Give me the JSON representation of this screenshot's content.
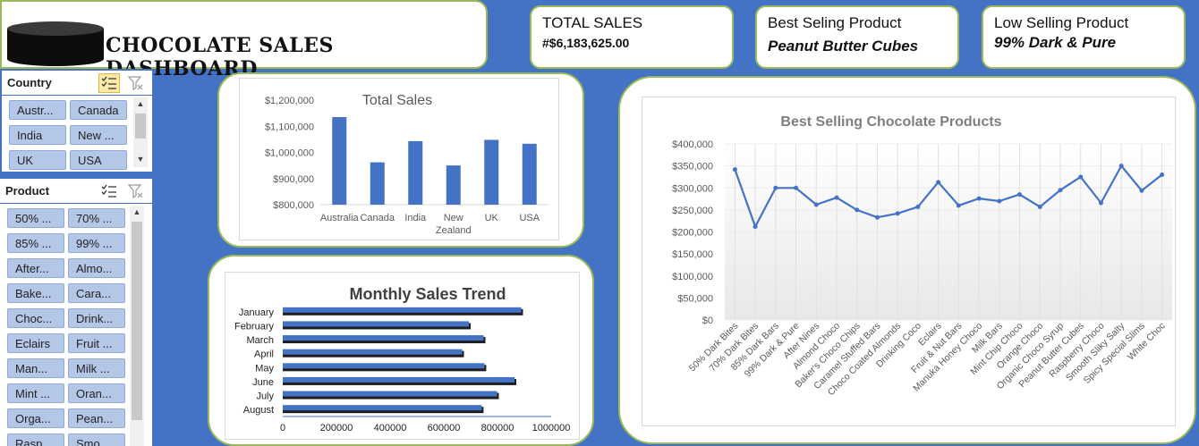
{
  "dashboard": {
    "title": "CHOCOLATE SALES DASHBOARD"
  },
  "kpis": {
    "total_sales_label": "TOTAL SALES",
    "total_sales_value": "#$6,183,625.00",
    "best_label": "Best Seling Product",
    "best_value": "Peanut Butter Cubes",
    "low_label": "Low Selling Product",
    "low_value": "99% Dark & Pure"
  },
  "country_slicer": {
    "title": "Country",
    "items": [
      "Austr...",
      "Canada",
      "India",
      "New ...",
      "UK",
      "USA"
    ]
  },
  "product_slicer": {
    "title": "Product",
    "items": [
      "50% ...",
      "70% ...",
      "85% ...",
      "99% ...",
      "After...",
      "Almo...",
      "Bake...",
      "Cara...",
      "Choc...",
      "Drink...",
      "Eclairs",
      "Fruit ...",
      "Man...",
      "Milk ...",
      "Mint ...",
      "Oran...",
      "Orga...",
      "Pean...",
      "Rasp...",
      "Smo..."
    ]
  },
  "colors": {
    "accent": "#4472c4",
    "card_border": "#9bbb59",
    "bar": "#4472c4",
    "slicer_item": "#b4c7e7"
  },
  "chart_data": [
    {
      "type": "bar",
      "title": "Total Sales",
      "categories": [
        "Australia",
        "Canada",
        "India",
        "New Zealand",
        "UK",
        "USA"
      ],
      "values": [
        1135000,
        962000,
        1043000,
        950000,
        1048000,
        1033000
      ],
      "ylim": [
        800000,
        1200000
      ],
      "yticks": [
        "$800,000",
        "$900,000",
        "$1,000,000",
        "$1,100,000",
        "$1,200,000"
      ],
      "grid": false
    },
    {
      "type": "bar",
      "orientation": "horizontal",
      "title": "Monthly Sales Trend",
      "categories": [
        "January",
        "February",
        "March",
        "April",
        "May",
        "June",
        "July",
        "August"
      ],
      "values": [
        895000,
        700000,
        755000,
        675000,
        758000,
        870000,
        805000,
        748000
      ],
      "xlim": [
        0,
        1000000
      ],
      "xticks": [
        "0",
        "200000",
        "400000",
        "600000",
        "800000",
        "1000000"
      ]
    },
    {
      "type": "line",
      "title": "Best Selling Chocolate Products",
      "categories": [
        "50% Dark Bites",
        "70% Dark Bites",
        "85% Dark Bars",
        "99% Dark & Pure",
        "After Nines",
        "Almond Choco",
        "Baker's Choco Chips",
        "Caramel Stuffed Bars",
        "Choco Coated Almonds",
        "Drinking Coco",
        "Eclairs",
        "Fruit & Nut Bars",
        "Manuka Honey Choco",
        "Milk Bars",
        "Mint Chip Choco",
        "Orange Choco",
        "Organic Choco Syrup",
        "Peanut Butter Cubes",
        "Raspberry Choco",
        "Smooth Sliky Salty",
        "Spicy Special Slims",
        "White Choc"
      ],
      "values": [
        342000,
        212000,
        300000,
        300000,
        262000,
        278000,
        250000,
        233000,
        242000,
        257000,
        313000,
        260000,
        276000,
        270000,
        285000,
        257000,
        295000,
        325000,
        266000,
        350000,
        294000,
        330000
      ],
      "ylim": [
        0,
        400000
      ],
      "yticks": [
        "$0",
        "$50,000",
        "$100,000",
        "$150,000",
        "$200,000",
        "$250,000",
        "$300,000",
        "$350,000",
        "$400,000"
      ],
      "grid": true
    }
  ]
}
